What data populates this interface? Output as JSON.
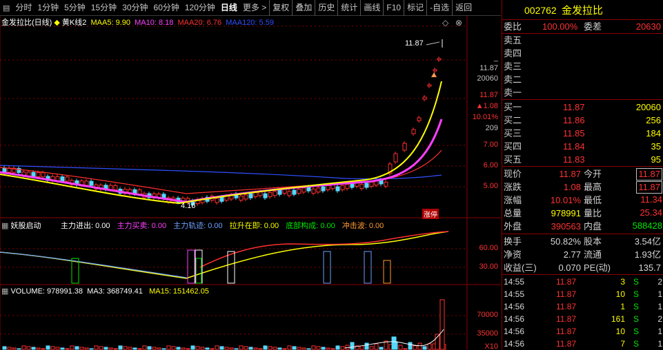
{
  "toolbar": {
    "items": [
      "分时",
      "1分钟",
      "5分钟",
      "15分钟",
      "30分钟",
      "60分钟",
      "120分钟",
      "日线",
      "更多",
      "复权",
      "叠加",
      "历史",
      "统计",
      "画线",
      "F10",
      "标记",
      "自选",
      "返回"
    ],
    "more_arrow": ">"
  },
  "main_chart": {
    "title": "金发拉比(日线)",
    "indicator_name": "黄K线2",
    "ma5": "MAA5: 9.90",
    "ma10": "MA10: 8.18",
    "ma20": "MAA20: 6.76",
    "ma120": "MAA120: 5.59",
    "price_axis": [
      "11.87",
      "20060",
      "11.87",
      "▲1.08",
      "10.01%",
      "209",
      "7.00",
      "6.00",
      "5.00"
    ],
    "high_marker": "11.87",
    "low_marker": "4.16",
    "badge": "涨停",
    "colors": {
      "ma5": "#ffff00",
      "ma10": "#ff40ff",
      "ma20": "#ff3030",
      "ma120": "#3050ff"
    }
  },
  "indicator_panel": {
    "name": "妖股启动",
    "fields": [
      {
        "label": "主力进出",
        "value": "0.00",
        "color": "#ffffff"
      },
      {
        "label": "主力买卖",
        "value": "0.00",
        "color": "#ff40ff"
      },
      {
        "label": "主力轨迹",
        "value": "0.00",
        "color": "#6ea0ff"
      },
      {
        "label": "拉升在即",
        "value": "0.00",
        "color": "#ffff00"
      },
      {
        "label": "底部构成",
        "value": "0.00",
        "color": "#00e600"
      },
      {
        "label": "冲击波",
        "value": "0.00",
        "color": "#ff9a30"
      }
    ],
    "axis": [
      "60.00",
      "30.00"
    ]
  },
  "volume_panel": {
    "volume": "VOLUME: 978991.38",
    "ma3": "MA3: 368749.41",
    "ma15": "MA15: 151462.05",
    "axis": [
      "70000",
      "35000",
      "X10"
    ]
  },
  "quote": {
    "code": "002762",
    "name": "金发拉比",
    "webi_label": "委比",
    "webi_value": "100.00%",
    "weicha_label": "委差",
    "weicha_value": "20630",
    "asks": [
      {
        "label": "卖五",
        "price": "",
        "vol": ""
      },
      {
        "label": "卖四",
        "price": "",
        "vol": ""
      },
      {
        "label": "卖三",
        "price": "",
        "vol": ""
      },
      {
        "label": "卖二",
        "price": "",
        "vol": ""
      },
      {
        "label": "卖一",
        "price": "",
        "vol": ""
      }
    ],
    "bids": [
      {
        "label": "买一",
        "price": "11.87",
        "vol": "20060"
      },
      {
        "label": "买二",
        "price": "11.86",
        "vol": "256"
      },
      {
        "label": "买三",
        "price": "11.85",
        "vol": "184"
      },
      {
        "label": "买四",
        "price": "11.84",
        "vol": "35"
      },
      {
        "label": "买五",
        "price": "11.83",
        "vol": "95"
      }
    ],
    "stats": [
      {
        "l1": "现价",
        "v1": "11.87",
        "l2": "今开",
        "v2": "11.87",
        "c1": "red",
        "c2": "red",
        "box2": true
      },
      {
        "l1": "涨跌",
        "v1": "1.08",
        "l2": "最高",
        "v2": "11.87",
        "c1": "red",
        "c2": "red",
        "box2": true
      },
      {
        "l1": "涨幅",
        "v1": "10.01%",
        "l2": "最低",
        "v2": "11.34",
        "c1": "red",
        "c2": "red",
        "box2": false
      },
      {
        "l1": "总量",
        "v1": "978991",
        "l2": "量比",
        "v2": "25.34",
        "c1": "yel",
        "c2": "red",
        "box2": false
      },
      {
        "l1": "外盘",
        "v1": "390563",
        "l2": "内盘",
        "v2": "588428",
        "c1": "red",
        "c2": "grn",
        "box2": false
      }
    ],
    "stats2": [
      {
        "l1": "换手",
        "v1": "50.82%",
        "l2": "股本",
        "v2": "3.54亿"
      },
      {
        "l1": "净资",
        "v1": "2.77",
        "l2": "流通",
        "v2": "1.93亿"
      },
      {
        "l1": "收益(三)",
        "v1": "0.070",
        "l2": "PE(动)",
        "v2": "135.7"
      }
    ],
    "ticks": [
      {
        "time": "14:55",
        "price": "11.87",
        "vol": "3",
        "side": "S",
        "n": "2"
      },
      {
        "time": "14:55",
        "price": "11.87",
        "vol": "10",
        "side": "S",
        "n": "1"
      },
      {
        "time": "14:56",
        "price": "11.87",
        "vol": "1",
        "side": "S",
        "n": "1"
      },
      {
        "time": "14:56",
        "price": "11.87",
        "vol": "161",
        "side": "S",
        "n": "2"
      },
      {
        "time": "14:56",
        "price": "11.87",
        "vol": "10",
        "side": "S",
        "n": "1"
      },
      {
        "time": "14:56",
        "price": "11.87",
        "vol": "7",
        "side": "S",
        "n": "1"
      }
    ]
  }
}
